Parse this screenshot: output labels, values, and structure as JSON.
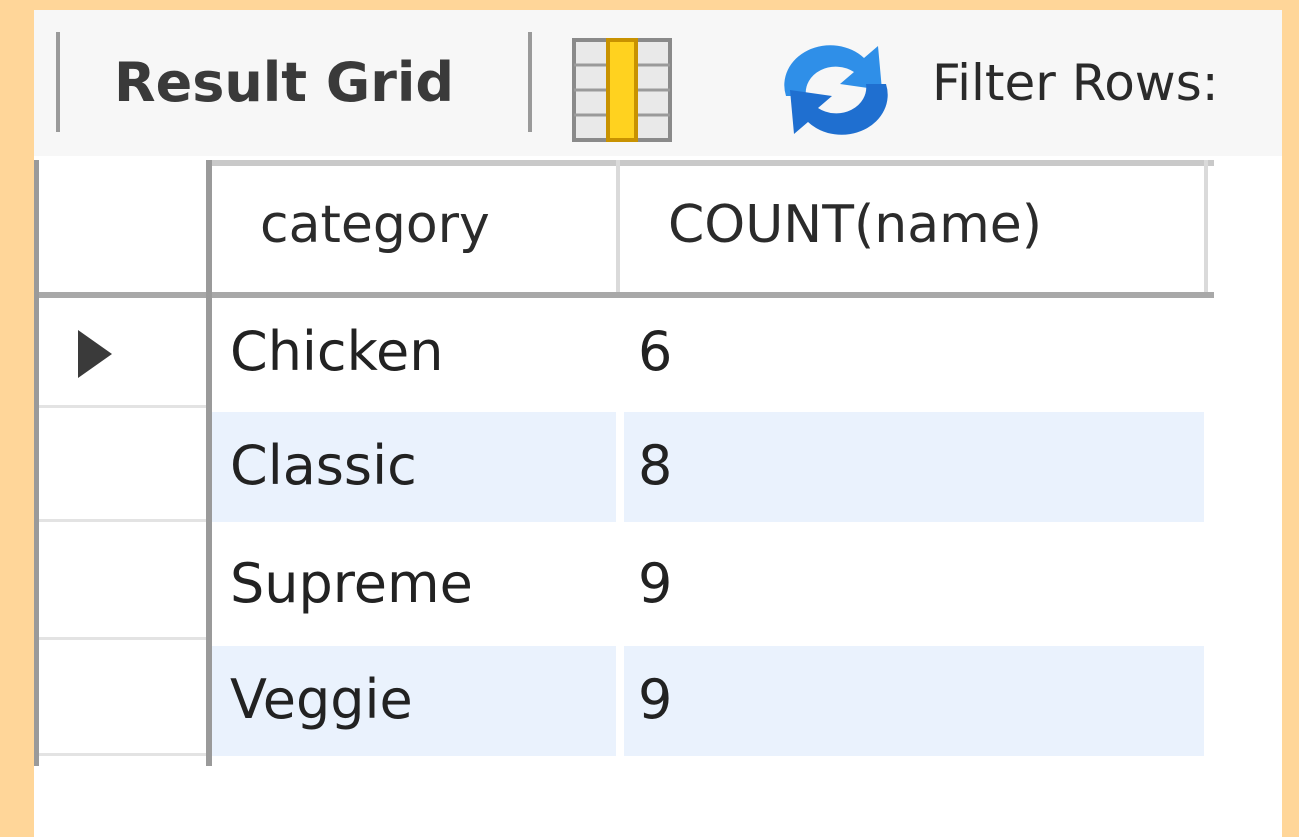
{
  "toolbar": {
    "result_grid_label": "Result Grid",
    "filter_label": "Filter Rows:",
    "icons": [
      "grid-layout-icon",
      "refresh-icon"
    ]
  },
  "grid": {
    "columns": [
      "category",
      "COUNT(name)"
    ],
    "rows": [
      {
        "category": "Chicken",
        "count": "6"
      },
      {
        "category": "Classic",
        "count": "8"
      },
      {
        "category": "Supreme",
        "count": "9"
      },
      {
        "category": "Veggie",
        "count": "9"
      }
    ],
    "selected_row_marker": "row-pointer-icon"
  },
  "colors": {
    "background": "#ffd699",
    "alt_row": "#eaf2fd",
    "grid_icon_yellow": "#ffd21f",
    "refresh_blue": "#2f8fe8"
  }
}
